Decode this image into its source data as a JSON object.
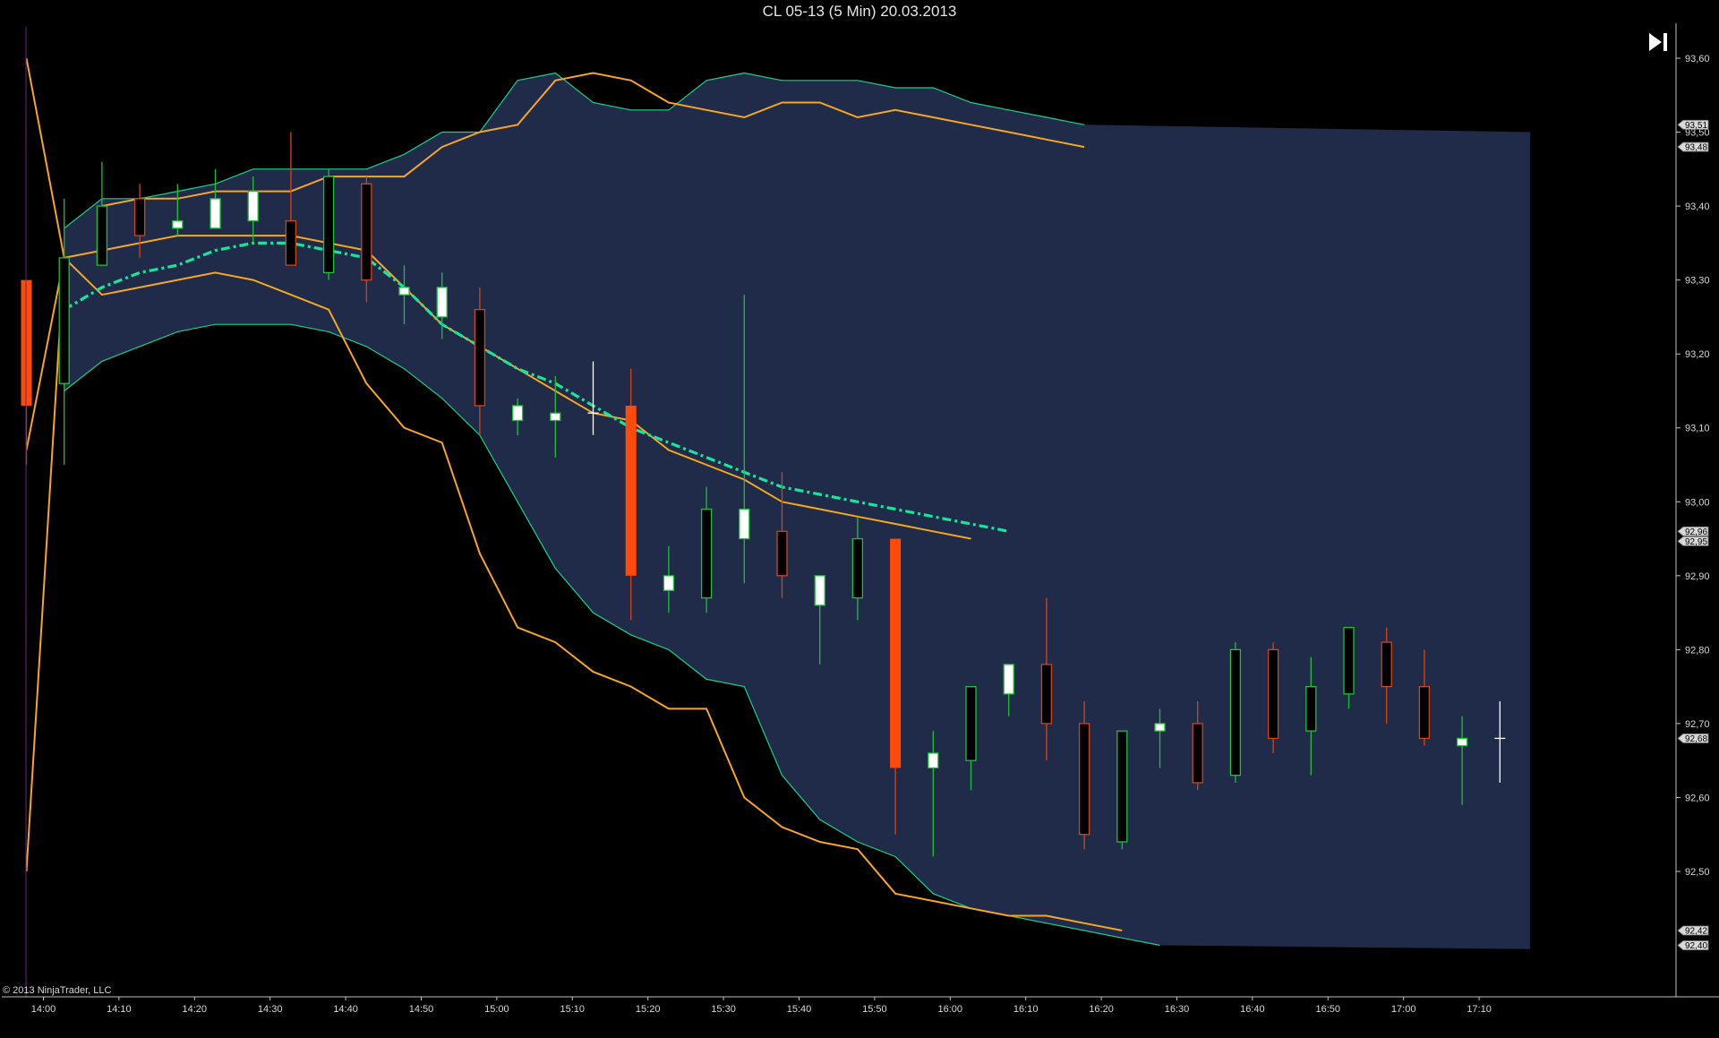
{
  "window": {
    "title": "CL 05-13 (5 Min)  20.03.2013"
  },
  "copyright": "© 2013 NinjaTrader, LLC",
  "toolbar": {
    "jump_icon": "jump-to-end-icon"
  },
  "colors": {
    "background": "#000000",
    "band_fill": "#1f2b48",
    "band_edge": "#19d08a",
    "orange": "#f5a623",
    "midline": "#18e49a",
    "up_outline": "#1fbf3a",
    "down_outline": "#d0451a",
    "up_body": "#ffffff",
    "down_body": "#000000",
    "solid_red": "#ff4a0a",
    "axis": "#bfbfbf"
  },
  "chart_data": {
    "type": "candlestick",
    "ylim": [
      92.36,
      93.63
    ],
    "y_ticks": [
      "93,60",
      "93,50",
      "93,40",
      "93,30",
      "93,20",
      "93,10",
      "93,00",
      "92,90",
      "92,80",
      "92,70",
      "92,60",
      "92,50"
    ],
    "x_ticks": [
      "14:00",
      "14:10",
      "14:20",
      "14:30",
      "14:40",
      "14:50",
      "15:00",
      "15:10",
      "15:20",
      "15:30",
      "15:40",
      "15:50",
      "16:00",
      "16:10",
      "16:20",
      "16:30",
      "16:40",
      "16:50",
      "17:00",
      "17:10"
    ],
    "price_markers": [
      "93,51",
      "93,48",
      "92,96",
      "92,95",
      "92,68",
      "92,42",
      "92,40"
    ],
    "candles": [
      {
        "o": 93.13,
        "h": 93.3,
        "l": 93.05,
        "c": 93.3,
        "style": "solid"
      },
      {
        "o": 93.16,
        "h": 93.41,
        "l": 93.05,
        "c": 93.33,
        "style": "outline"
      },
      {
        "o": 93.32,
        "h": 93.46,
        "l": 93.32,
        "c": 93.4,
        "style": "outline"
      },
      {
        "o": 93.41,
        "h": 93.43,
        "l": 93.33,
        "c": 93.36,
        "style": "outline"
      },
      {
        "o": 93.37,
        "h": 93.43,
        "l": 93.36,
        "c": 93.38,
        "style": "filled"
      },
      {
        "o": 93.37,
        "h": 93.45,
        "l": 93.37,
        "c": 93.41,
        "style": "filled"
      },
      {
        "o": 93.38,
        "h": 93.44,
        "l": 93.35,
        "c": 93.42,
        "style": "filled"
      },
      {
        "o": 93.38,
        "h": 93.5,
        "l": 93.32,
        "c": 93.32,
        "style": "outline"
      },
      {
        "o": 93.31,
        "h": 93.45,
        "l": 93.3,
        "c": 93.44,
        "style": "outline"
      },
      {
        "o": 93.43,
        "h": 93.44,
        "l": 93.27,
        "c": 93.3,
        "style": "outline"
      },
      {
        "o": 93.28,
        "h": 93.32,
        "l": 93.24,
        "c": 93.29,
        "style": "filled"
      },
      {
        "o": 93.25,
        "h": 93.31,
        "l": 93.22,
        "c": 93.29,
        "style": "filled"
      },
      {
        "o": 93.26,
        "h": 93.29,
        "l": 93.09,
        "c": 93.13,
        "style": "outline"
      },
      {
        "o": 93.11,
        "h": 93.14,
        "l": 93.09,
        "c": 93.13,
        "style": "filled"
      },
      {
        "o": 93.11,
        "h": 93.17,
        "l": 93.06,
        "c": 93.12,
        "style": "filled"
      },
      {
        "o": 93.12,
        "h": 93.19,
        "l": 93.09,
        "c": 93.12,
        "style": "doji"
      },
      {
        "o": 93.13,
        "h": 93.18,
        "l": 92.84,
        "c": 92.9,
        "style": "solid"
      },
      {
        "o": 92.88,
        "h": 92.94,
        "l": 92.85,
        "c": 92.9,
        "style": "filled"
      },
      {
        "o": 92.87,
        "h": 93.02,
        "l": 92.85,
        "c": 92.99,
        "style": "outline"
      },
      {
        "o": 92.95,
        "h": 93.28,
        "l": 92.89,
        "c": 92.99,
        "style": "filled"
      },
      {
        "o": 92.96,
        "h": 93.04,
        "l": 92.87,
        "c": 92.9,
        "style": "outline"
      },
      {
        "o": 92.86,
        "h": 92.9,
        "l": 92.78,
        "c": 92.9,
        "style": "filled"
      },
      {
        "o": 92.87,
        "h": 92.98,
        "l": 92.84,
        "c": 92.95,
        "style": "outline"
      },
      {
        "o": 92.95,
        "h": 92.95,
        "l": 92.55,
        "c": 92.64,
        "style": "solid"
      },
      {
        "o": 92.64,
        "h": 92.69,
        "l": 92.52,
        "c": 92.66,
        "style": "filled"
      },
      {
        "o": 92.65,
        "h": 92.75,
        "l": 92.61,
        "c": 92.75,
        "style": "outline"
      },
      {
        "o": 92.74,
        "h": 92.78,
        "l": 92.71,
        "c": 92.78,
        "style": "filled"
      },
      {
        "o": 92.78,
        "h": 92.87,
        "l": 92.65,
        "c": 92.7,
        "style": "outline"
      },
      {
        "o": 92.7,
        "h": 92.73,
        "l": 92.53,
        "c": 92.55,
        "style": "outline"
      },
      {
        "o": 92.54,
        "h": 92.69,
        "l": 92.53,
        "c": 92.69,
        "style": "outline"
      },
      {
        "o": 92.69,
        "h": 92.72,
        "l": 92.64,
        "c": 92.7,
        "style": "filled"
      },
      {
        "o": 92.7,
        "h": 92.73,
        "l": 92.61,
        "c": 92.62,
        "style": "outline"
      },
      {
        "o": 92.63,
        "h": 92.81,
        "l": 92.62,
        "c": 92.8,
        "style": "outline"
      },
      {
        "o": 92.8,
        "h": 92.81,
        "l": 92.66,
        "c": 92.68,
        "style": "outline"
      },
      {
        "o": 92.69,
        "h": 92.79,
        "l": 92.63,
        "c": 92.75,
        "style": "outline"
      },
      {
        "o": 92.74,
        "h": 92.83,
        "l": 92.72,
        "c": 92.83,
        "style": "outline"
      },
      {
        "o": 92.81,
        "h": 92.83,
        "l": 92.7,
        "c": 92.75,
        "style": "outline"
      },
      {
        "o": 92.75,
        "h": 92.8,
        "l": 92.67,
        "c": 92.68,
        "style": "outline"
      },
      {
        "o": 92.67,
        "h": 92.71,
        "l": 92.59,
        "c": 92.68,
        "style": "filled"
      },
      {
        "o": 92.68,
        "h": 92.73,
        "l": 92.62,
        "c": 92.68,
        "style": "doji"
      }
    ],
    "band_upper": [
      93.37,
      93.41,
      93.41,
      93.42,
      93.43,
      93.45,
      93.45,
      93.45,
      93.45,
      93.47,
      93.5,
      93.5,
      93.57,
      93.58,
      93.54,
      93.53,
      93.53,
      93.57,
      93.58,
      93.57,
      93.57,
      93.57,
      93.56,
      93.56,
      93.54,
      93.53,
      93.52,
      93.51
    ],
    "band_lower": [
      93.15,
      93.19,
      93.21,
      93.23,
      93.24,
      93.24,
      93.24,
      93.23,
      93.21,
      93.18,
      93.14,
      93.09,
      93.0,
      92.91,
      92.85,
      92.82,
      92.8,
      92.76,
      92.75,
      92.63,
      92.57,
      92.54,
      92.52,
      92.47,
      92.45,
      92.44,
      92.43,
      92.42,
      92.41,
      92.4
    ],
    "orange_top": [
      93.4,
      93.41,
      93.41,
      93.42,
      93.42,
      93.42,
      93.44,
      93.44,
      93.44,
      93.48,
      93.5,
      93.51,
      93.57,
      93.58,
      93.57,
      93.54,
      93.53,
      93.52,
      93.54,
      93.54,
      93.52,
      93.53,
      93.52,
      93.51,
      93.5,
      93.49,
      93.48
    ],
    "orange_upper_mid": [
      93.34,
      93.35,
      93.36,
      93.36,
      93.36,
      93.36,
      93.35,
      93.34,
      93.29,
      93.24,
      93.21,
      93.18,
      93.15,
      93.12,
      93.11,
      93.07,
      93.05,
      93.03,
      93.0,
      92.99,
      92.98,
      92.97,
      92.96,
      92.95
    ],
    "midline": [
      93.26,
      93.29,
      93.31,
      93.32,
      93.34,
      93.35,
      93.35,
      93.34,
      93.33,
      93.29,
      93.24,
      93.21,
      93.18,
      93.16,
      93.13,
      93.1,
      93.08,
      93.06,
      93.04,
      93.02,
      93.01,
      93.0,
      92.99,
      92.98,
      92.97,
      92.96
    ],
    "orange_lower_mid": [
      93.28,
      93.29,
      93.3,
      93.31,
      93.3,
      93.28,
      93.26,
      93.16,
      93.1,
      93.08,
      92.93,
      92.83,
      92.81,
      92.77,
      92.75,
      92.72,
      92.72,
      92.6,
      92.56,
      92.54,
      92.53,
      92.47,
      92.46,
      92.45,
      92.44,
      92.44,
      92.43,
      92.42
    ],
    "orange_spike": [
      93.07,
      93.6,
      92.5,
      93.33
    ]
  }
}
